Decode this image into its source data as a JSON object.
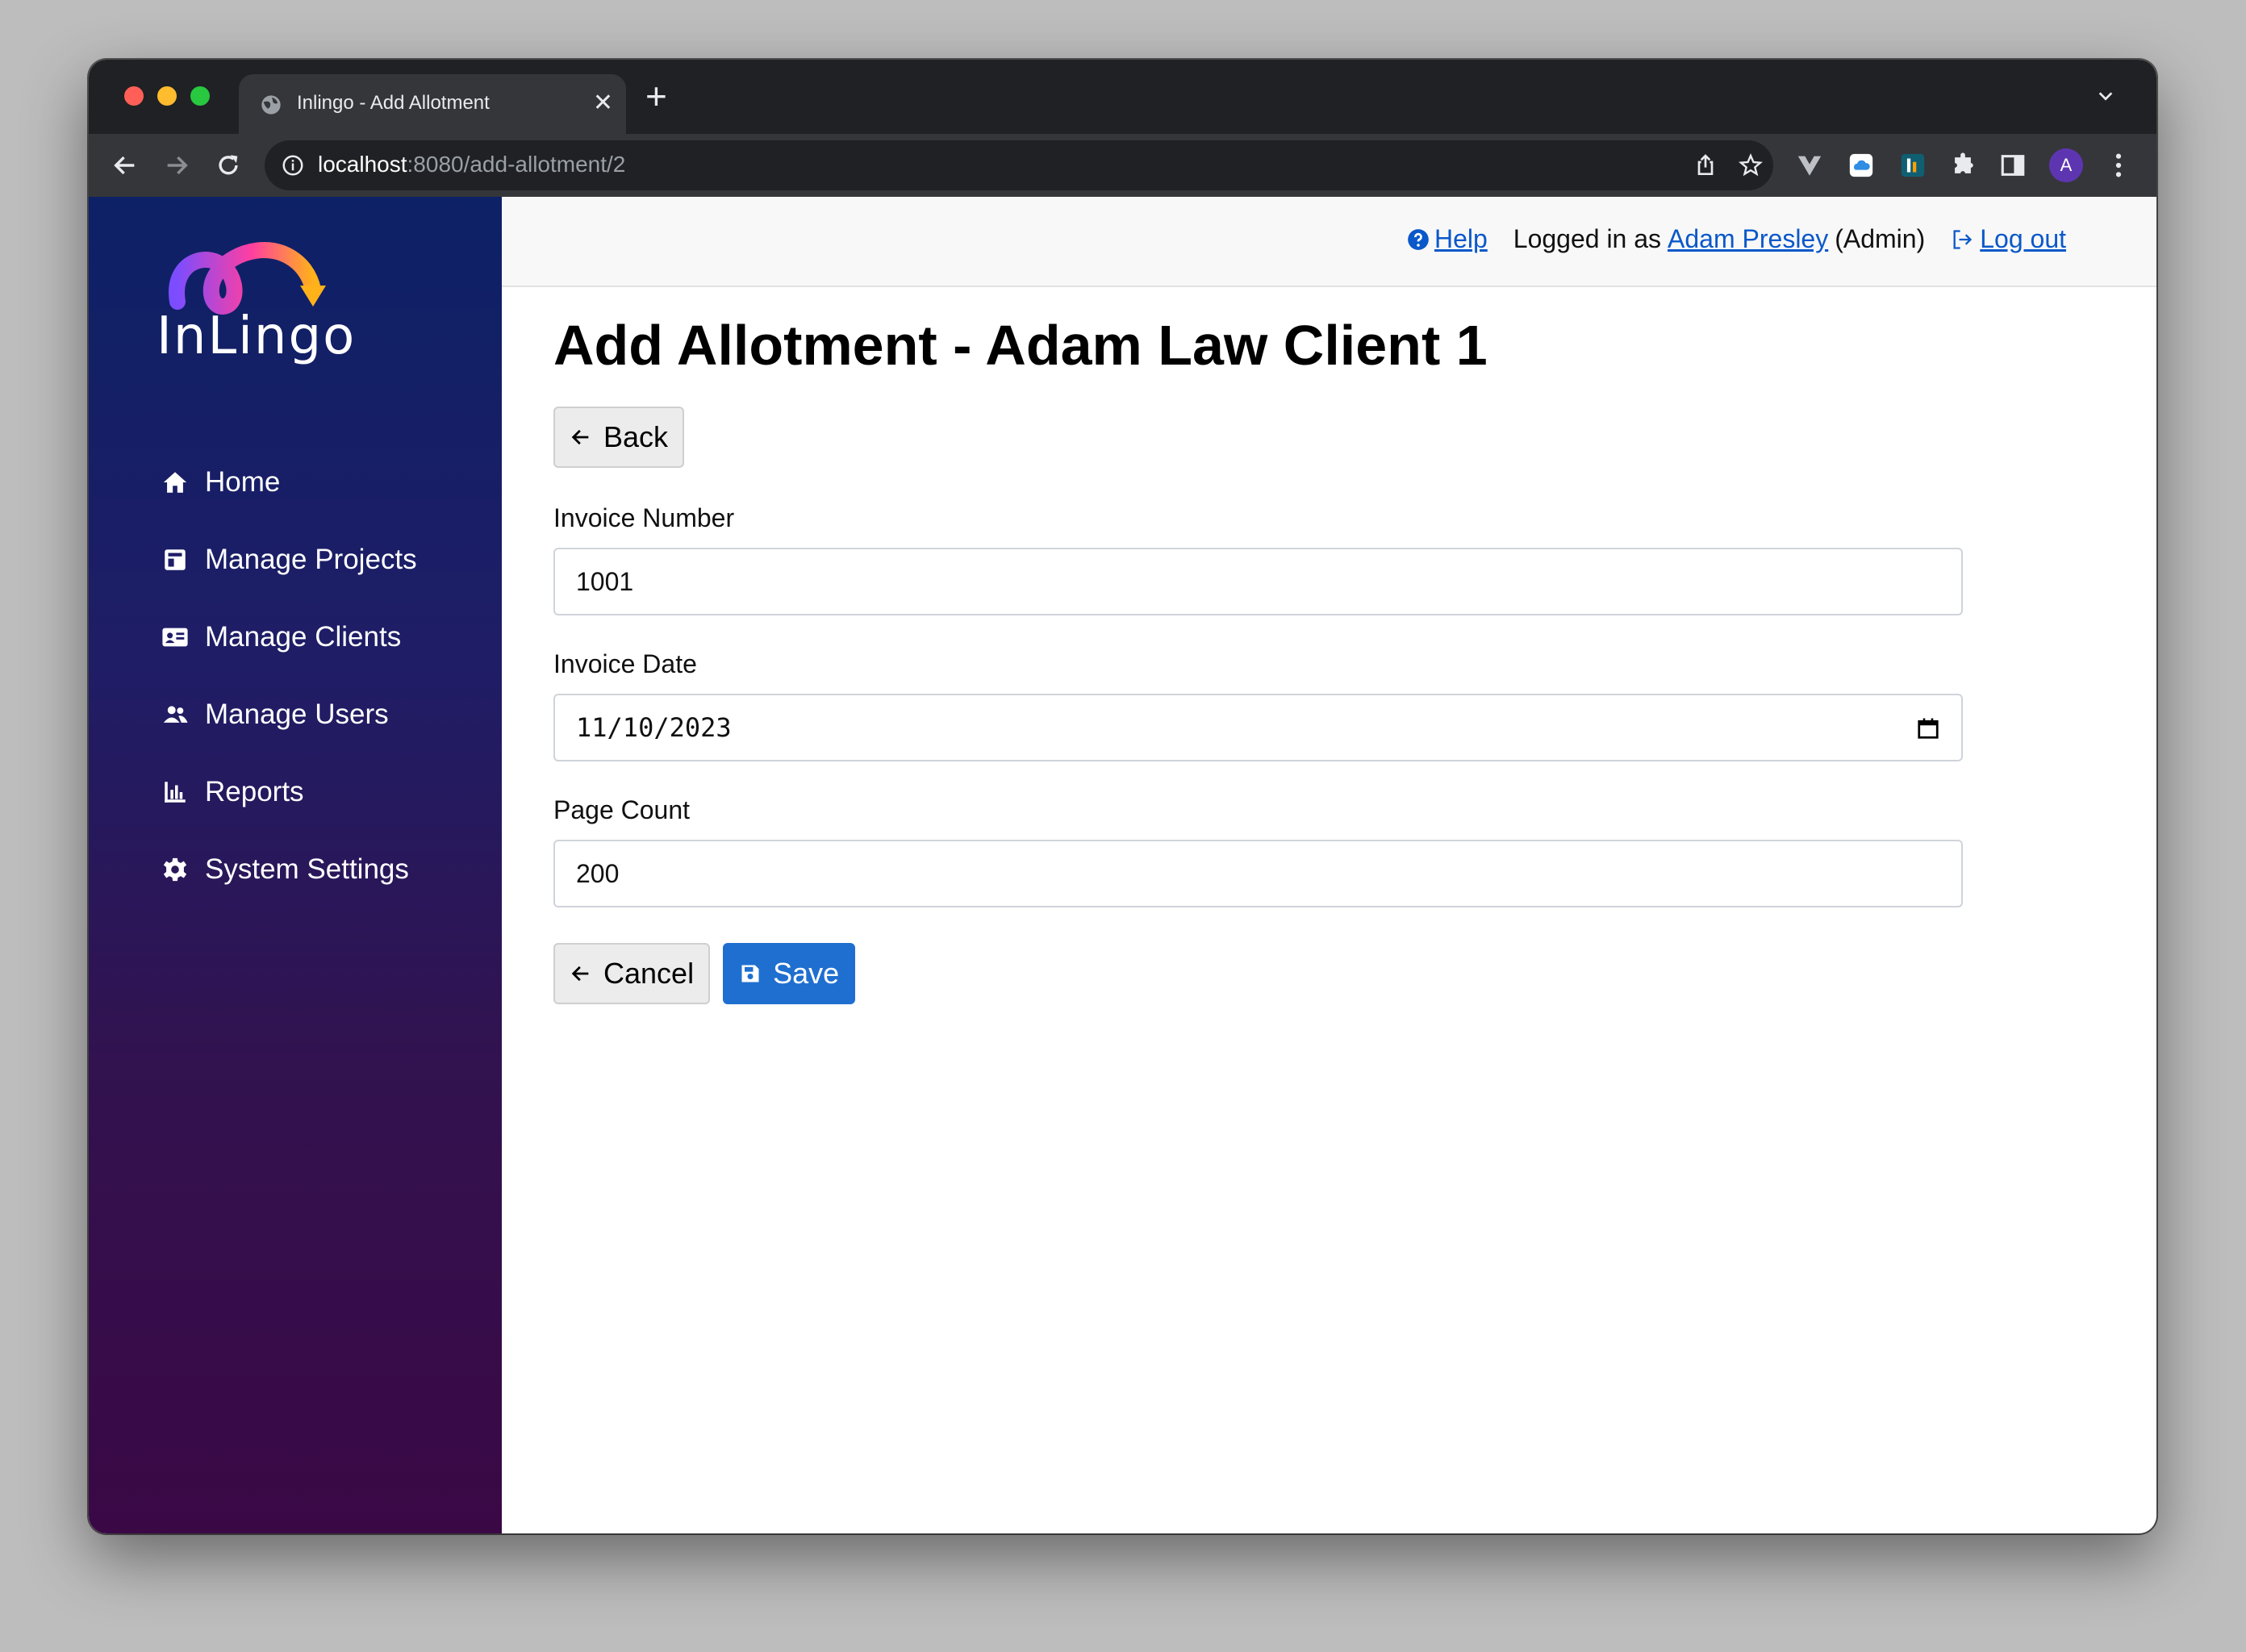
{
  "browser": {
    "tab_title": "Inlingo - Add Allotment",
    "url_host": "localhost",
    "url_rest": ":8080/add-allotment/2",
    "profile_initial": "A"
  },
  "app": {
    "logo_text": "InLingo"
  },
  "sidebar": {
    "items": [
      {
        "label": "Home",
        "icon": "home-icon"
      },
      {
        "label": "Manage Projects",
        "icon": "projects-icon"
      },
      {
        "label": "Manage Clients",
        "icon": "clients-card-icon"
      },
      {
        "label": "Manage Users",
        "icon": "users-icon"
      },
      {
        "label": "Reports",
        "icon": "bar-chart-icon"
      },
      {
        "label": "System Settings",
        "icon": "gear-icon"
      }
    ]
  },
  "topbar": {
    "help_label": "Help",
    "logged_in_prefix": "Logged in as",
    "user_name": "Adam Presley",
    "user_role": "(Admin)",
    "logout_label": "Log out"
  },
  "main": {
    "title": "Add Allotment - Adam Law Client 1",
    "back_label": "Back",
    "invoice_number_label": "Invoice Number",
    "invoice_number_value": "1001",
    "invoice_date_label": "Invoice Date",
    "invoice_date_value": "11/10/2023",
    "page_count_label": "Page Count",
    "page_count_value": "200",
    "cancel_label": "Cancel",
    "save_label": "Save"
  },
  "colors": {
    "primary_button": "#1f6fd0",
    "link": "#0a58ca",
    "sidebar_top": "#0d2166",
    "sidebar_bottom": "#3a0845"
  }
}
